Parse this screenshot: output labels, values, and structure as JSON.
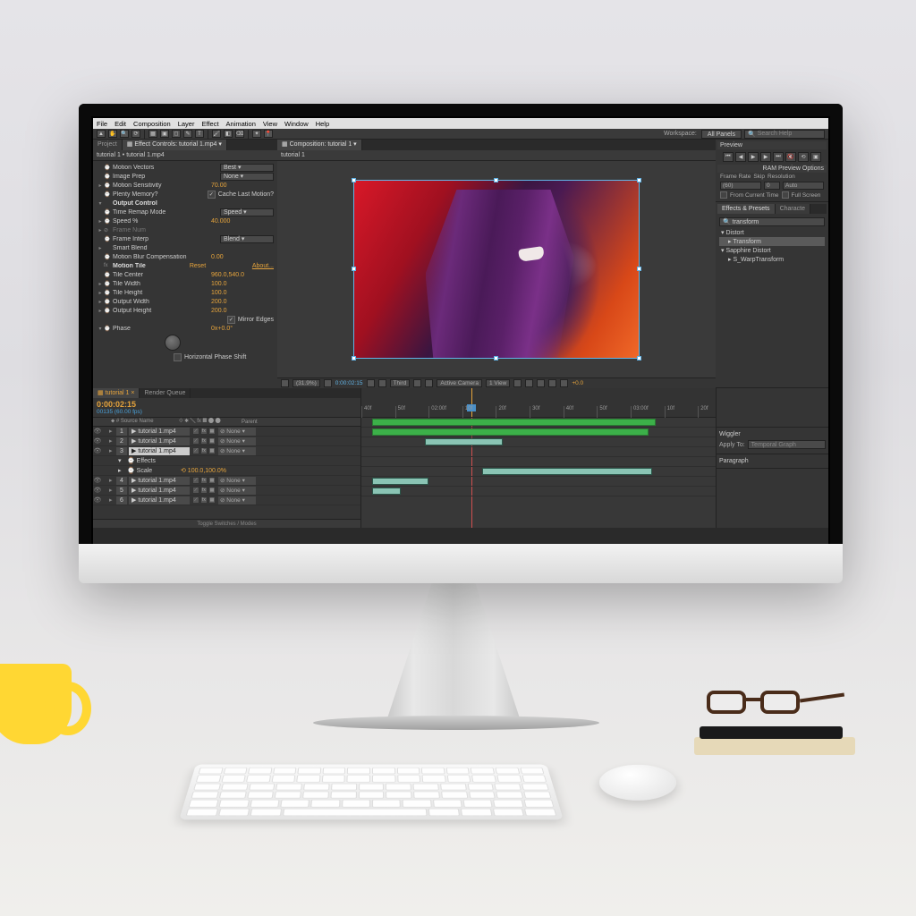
{
  "menu": [
    "File",
    "Edit",
    "Composition",
    "Layer",
    "Effect",
    "Animation",
    "View",
    "Window",
    "Help"
  ],
  "workspace": {
    "label": "Workspace:",
    "value": "All Panels"
  },
  "search": {
    "placeholder": "Search Help"
  },
  "project": {
    "tab_project": "Project",
    "tab_ec": "Effect Controls: tutorial 1.mp4",
    "breadcrumb": "tutorial 1 • tutorial 1.mp4"
  },
  "effects_rows": [
    {
      "tw": "",
      "ic": "⌚",
      "label": "Motion Vectors",
      "drop": "Best"
    },
    {
      "tw": "",
      "ic": "⌚",
      "label": "Image Prep",
      "drop": "None"
    },
    {
      "tw": "▸",
      "ic": "⌚",
      "label": "Motion Sensitivity",
      "val": "70.00"
    },
    {
      "tw": "",
      "ic": "⌚",
      "label": "Plenty Memory?",
      "chk": true,
      "chklabel": "Cache Last Motion?"
    },
    {
      "tw": "▾",
      "ic": "",
      "label": "Output Control",
      "section": true
    },
    {
      "tw": "",
      "ic": "⌚",
      "label": "Time Remap Mode",
      "drop": "Speed"
    },
    {
      "tw": "▸",
      "ic": "⌚",
      "label": "Speed %",
      "val": "40.000"
    },
    {
      "tw": "▸",
      "ic": "⊘",
      "label": "Frame Num",
      "val": "",
      "dim": true
    },
    {
      "tw": "",
      "ic": "⌚",
      "label": "Frame Interp",
      "drop": "Blend"
    },
    {
      "tw": "▸",
      "ic": "",
      "label": "Smart Blend",
      "val": ""
    },
    {
      "tw": "",
      "ic": "⌚",
      "label": "Motion Blur Compensation",
      "val": "0.00"
    },
    {
      "tw": "",
      "ic": "fx",
      "label": "Motion Tile",
      "val": "Reset",
      "section": true,
      "about": "About..."
    },
    {
      "tw": "",
      "ic": "⌚",
      "label": "Tile Center",
      "val": "960.0,540.0"
    },
    {
      "tw": "▸",
      "ic": "⌚",
      "label": "Tile Width",
      "val": "100.0"
    },
    {
      "tw": "▸",
      "ic": "⌚",
      "label": "Tile Height",
      "val": "100.0"
    },
    {
      "tw": "▸",
      "ic": "⌚",
      "label": "Output Width",
      "val": "200.0"
    },
    {
      "tw": "▸",
      "ic": "⌚",
      "label": "Output Height",
      "val": "200.0"
    },
    {
      "tw": "",
      "ic": "",
      "label": "",
      "chk": true,
      "chklabel": "Mirror Edges"
    },
    {
      "tw": "▾",
      "ic": "⌚",
      "label": "Phase",
      "val": "0x+0.0°"
    }
  ],
  "effects_footer": {
    "chk": false,
    "label": "Horizontal Phase Shift"
  },
  "comp": {
    "tab": "Composition: tutorial 1",
    "title": "tutorial 1"
  },
  "comp_footer": {
    "zoom": "(31.9%)",
    "time": "0:00:02:15",
    "res": "Third",
    "camera": "Active Camera",
    "view": "1 View",
    "exposure": "+0.0"
  },
  "preview": {
    "title": "Preview",
    "ram": "RAM Preview Options",
    "framerate_lbl": "Frame Rate",
    "skip_lbl": "Skip",
    "res_lbl": "Resolution",
    "framerate": "(60)",
    "skip": "0",
    "res": "Auto",
    "fromcurrent": "From Current Time",
    "fullscreen": "Full Screen"
  },
  "ep": {
    "tab1": "Effects & Presets",
    "tab2": "Characte",
    "search": "transform",
    "cat1": "Distort",
    "item1": "Transform",
    "cat2": "Sapphire Distort",
    "item2": "S_WarpTransform"
  },
  "timeline": {
    "tab1": "tutorial 1",
    "tab2": "Render Queue",
    "timecode": "0:00:02:15",
    "frames": "00135 (60.00 fps)",
    "col_source": "Source Name",
    "col_parent": "Parent",
    "layers": [
      {
        "n": "1",
        "name": "tutorial 1.mp4",
        "mode": "None"
      },
      {
        "n": "2",
        "name": "tutorial 1.mp4",
        "mode": "None"
      },
      {
        "n": "3",
        "name": "tutorial 1.mp4",
        "mode": "None",
        "sel": true
      },
      {
        "prop": true,
        "name": "Effects"
      },
      {
        "prop": true,
        "name": "Scale",
        "val": "100.0,100.0%"
      },
      {
        "n": "4",
        "name": "tutorial 1.mp4",
        "mode": "None"
      },
      {
        "n": "5",
        "name": "tutorial 1.mp4",
        "mode": "None"
      },
      {
        "n": "6",
        "name": "tutorial 1.mp4",
        "mode": "None"
      }
    ],
    "toggle": "Toggle Switches / Modes",
    "ticks": [
      "40f",
      "50f",
      "02:00f",
      "10f",
      "20f",
      "30f",
      "40f",
      "50f",
      "03:00f",
      "10f",
      "20f"
    ]
  },
  "wiggler": {
    "title": "Wiggler",
    "apply": "Apply To:",
    "applyval": "Temporal Graph"
  },
  "paragraph": {
    "title": "Paragraph"
  }
}
